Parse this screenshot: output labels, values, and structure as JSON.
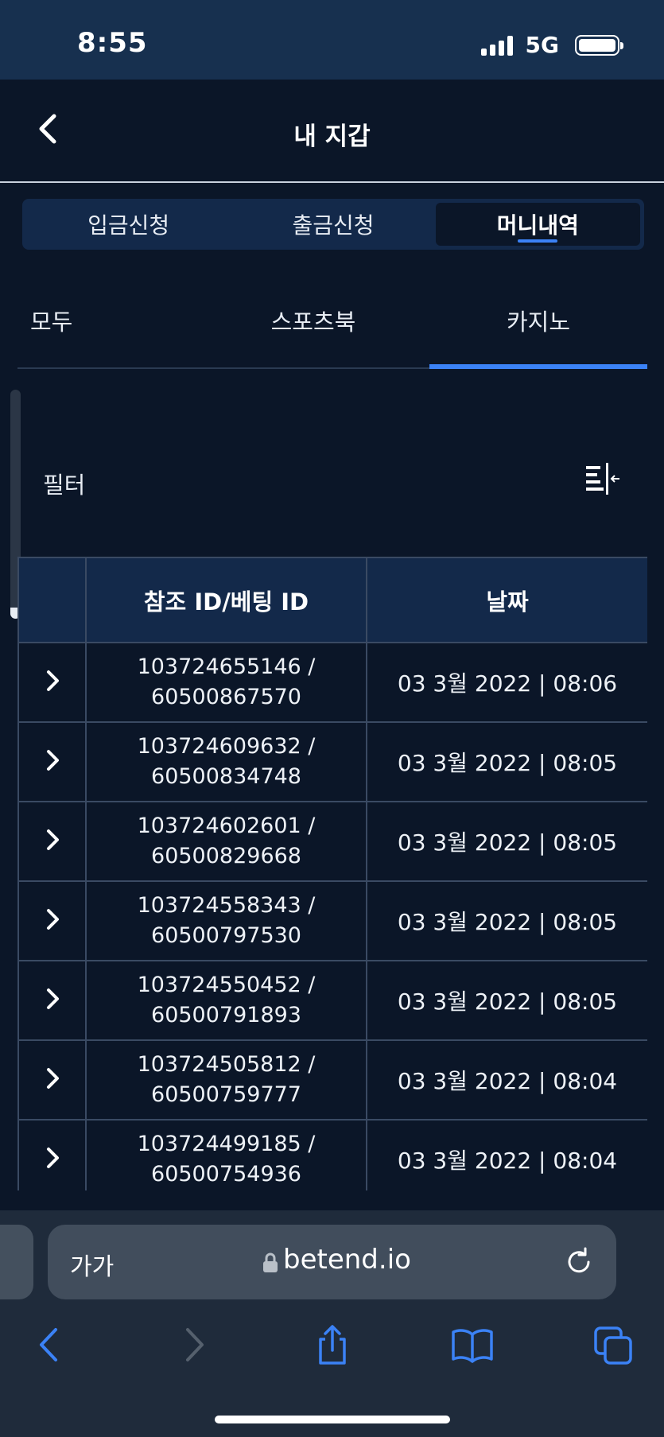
{
  "status": {
    "time": "8:55",
    "network": "5G"
  },
  "header": {
    "title": "내 지갑"
  },
  "segments": [
    {
      "label": "입금신청"
    },
    {
      "label": "출금신청"
    },
    {
      "label": "머니내역"
    }
  ],
  "subtabs": [
    {
      "label": "모두"
    },
    {
      "label": "스포츠북"
    },
    {
      "label": "카지노"
    }
  ],
  "filter": {
    "label": "필터"
  },
  "table": {
    "headers": {
      "expand": "",
      "ref_id": "참조 ID/베팅 ID",
      "date": "날짜"
    },
    "rows": [
      {
        "ref": "103724655146 /",
        "bet": "60500867570",
        "date": "03 3월 2022 | 08:06"
      },
      {
        "ref": "103724609632 /",
        "bet": "60500834748",
        "date": "03 3월 2022 | 08:05"
      },
      {
        "ref": "103724602601 /",
        "bet": "60500829668",
        "date": "03 3월 2022 | 08:05"
      },
      {
        "ref": "103724558343 /",
        "bet": "60500797530",
        "date": "03 3월 2022 | 08:05"
      },
      {
        "ref": "103724550452 /",
        "bet": "60500791893",
        "date": "03 3월 2022 | 08:05"
      },
      {
        "ref": "103724505812 /",
        "bet": "60500759777",
        "date": "03 3월 2022 | 08:04"
      },
      {
        "ref": "103724499185 /",
        "bet": "60500754936",
        "date": "03 3월 2022 | 08:04"
      }
    ]
  },
  "browser": {
    "text_size": "가가",
    "url": "betend.io"
  },
  "colors": {
    "background": "#0b1628",
    "accent": "#3b82f6",
    "header_cell": "#13294a",
    "status_bar": "#17304f",
    "browser_bar": "#1f2b3b",
    "ios_blue": "#3b82f6"
  }
}
